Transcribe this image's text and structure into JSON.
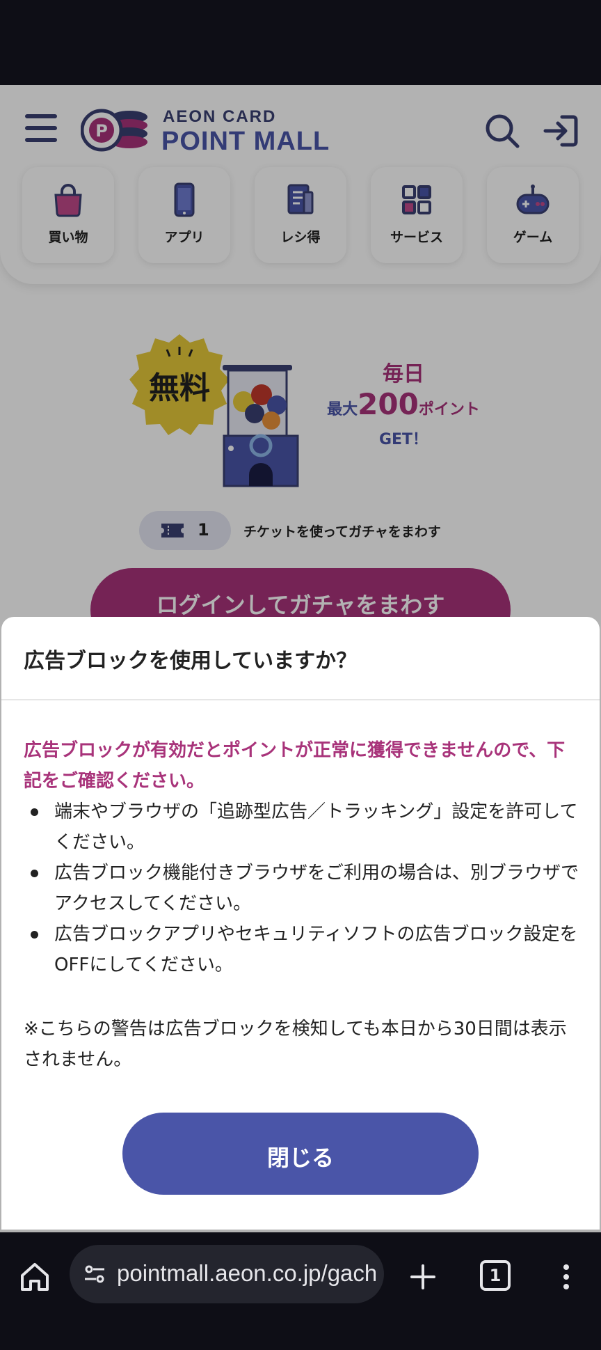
{
  "header": {
    "logo_top": "AEON CARD",
    "logo_bottom": "POINT MALL",
    "categories": [
      {
        "label": "買い物",
        "icon": "shopping-bag-icon"
      },
      {
        "label": "アプリ",
        "icon": "smartphone-icon"
      },
      {
        "label": "レシ得",
        "icon": "receipt-icon"
      },
      {
        "label": "サービス",
        "icon": "grid-icon"
      },
      {
        "label": "ゲーム",
        "icon": "gamepad-icon"
      }
    ]
  },
  "hero": {
    "badge": "無料",
    "line1": "毎日",
    "line2_prefix": "最大",
    "line2_number": "200",
    "line2_suffix": "ポイント",
    "line3": "GET！"
  },
  "ticket": {
    "count": "1",
    "text": "チケットを使ってガチャをまわす"
  },
  "gacha_button": "ログインしてガチャをまわす",
  "modal": {
    "title": "広告ブロックを使用していますか？",
    "warning": "広告ブロックが有効だとポイントが正常に獲得できませんので、下記をご確認ください。",
    "items": [
      "端末やブラウザの「追跡型広告／トラッキング」設定を許可してください。",
      "広告ブロック機能付きブラウザをご利用の場合は、別ブラウザでアクセスしてください。",
      "広告ブロックアプリやセキュリティソフトの広告ブロック設定をOFFにしてください。"
    ],
    "note": "※こちらの警告は広告ブロックを検知しても本日から30日間は表示されません。",
    "close_label": "閉じる"
  },
  "browser": {
    "url": "pointmall.aeon.co.jp/gacha",
    "tab_count": "1"
  },
  "colors": {
    "brand_navy": "#4a55a8",
    "brand_magenta": "#a8337a",
    "badge_yellow": "#e6c93a"
  }
}
